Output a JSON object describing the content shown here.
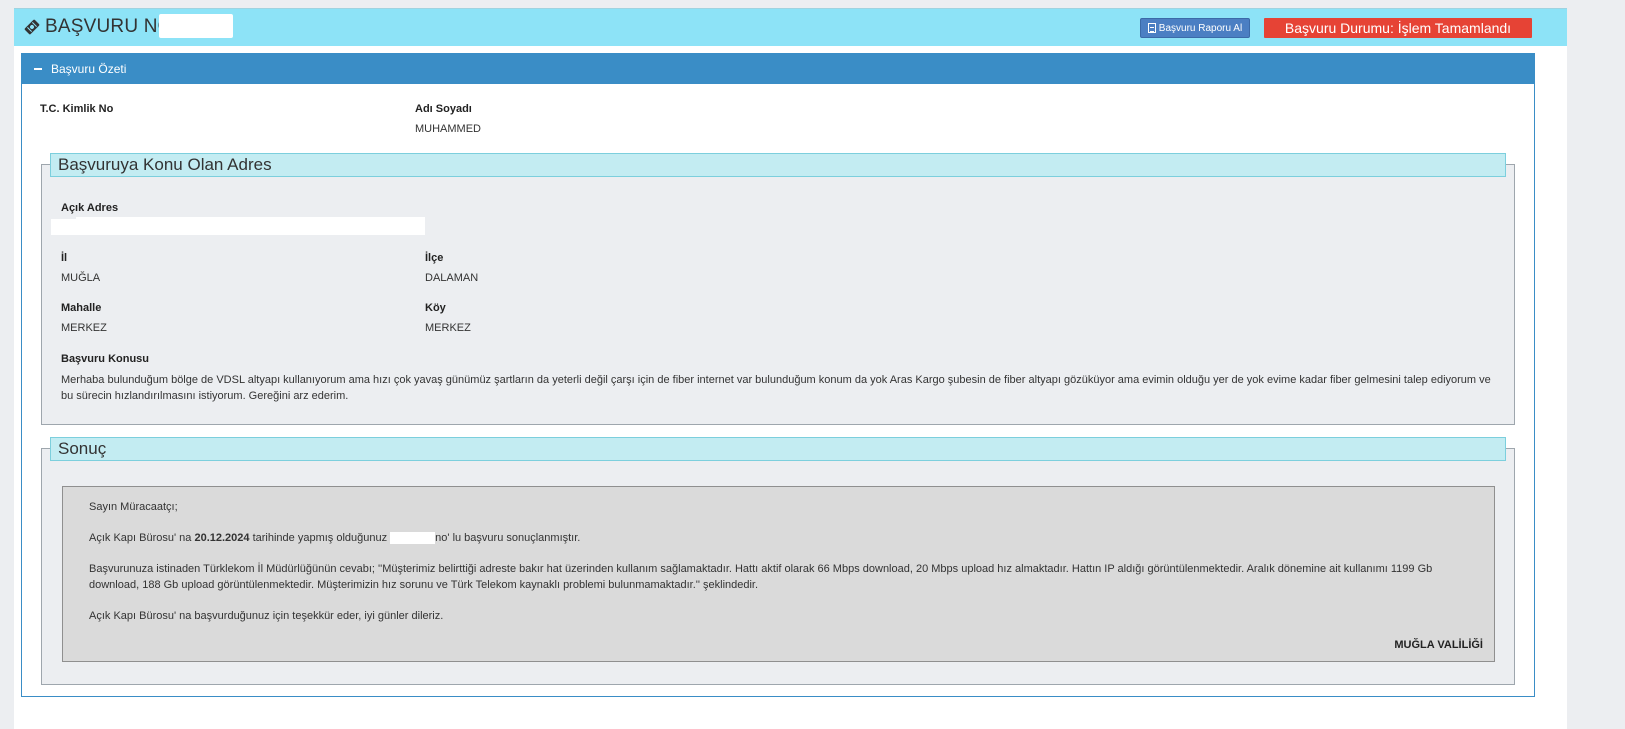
{
  "header": {
    "title": "BAŞVURU NO:",
    "report_button": "Başvuru Raporu Al",
    "status": "Başvuru Durumu: İşlem Tamamlandı"
  },
  "summary": {
    "title": "Başvuru Özeti",
    "tc_label": "T.C. Kimlik No",
    "name_label": "Adı Soyadı",
    "name_value": "MUHAMMED"
  },
  "address": {
    "legend": "Başvuruya Konu Olan Adres",
    "open_address_label": "Açık Adres",
    "il_label": "İl",
    "il_value": "MUĞLA",
    "ilce_label": "İlçe",
    "ilce_value": "DALAMAN",
    "mahalle_label": "Mahalle",
    "mahalle_value": "MERKEZ",
    "koy_label": "Köy",
    "koy_value": "MERKEZ",
    "konu_label": "Başvuru Konusu",
    "konu_text": "Merhaba bulunduğum bölge de VDSL altyapı kullanıyorum ama hızı çok yavaş günümüz şartların da yeterli değil çarşı için de fiber internet var bulunduğum konum da yok Aras Kargo şubesin de fiber altyapı gözüküyor ama evimin olduğu yer de yok evime kadar fiber gelmesini talep ediyorum ve bu sürecin hızlandırılmasını istiyorum. Gereğini arz ederim."
  },
  "result": {
    "legend": "Sonuç",
    "greeting": "Sayın Müracaatçı;",
    "line2_a": "Açık Kapı Bürosu' na",
    "line2_date": "20.12.2024",
    "line2_b": "tarihinde yapmış olduğunuz",
    "line2_c": "no' lu başvuru sonuçlanmıştır.",
    "line3": "Başvurunuza istinaden Türklekom İl Müdürlüğünün cevabı; ''Müşterimiz belirttiği adreste bakır hat üzerinden kullanım sağlamaktadır. Hattı aktif olarak 66 Mbps download, 20 Mbps upload hız almaktadır. Hattın IP aldığı görüntülenmektedir. Aralık dönemine ait kullanımı 1199 Gb download, 188 Gb upload görüntülenmektedir. Müşterimizin hız sorunu ve Türk Telekom kaynaklı problemi bulunmamaktadır.'' şeklindedir.",
    "line4": "Açık Kapı Bürosu' na başvurduğunuz için teşekkür eder, iyi günler dileriz.",
    "signature": "MUĞLA VALİLİĞİ"
  },
  "colors": {
    "header_bg": "#8de3f7",
    "panel_blue": "#3a8dc6",
    "report_button": "#4b7fc3",
    "status_red": "#e64335",
    "legend_bg": "#c3ecf2"
  }
}
